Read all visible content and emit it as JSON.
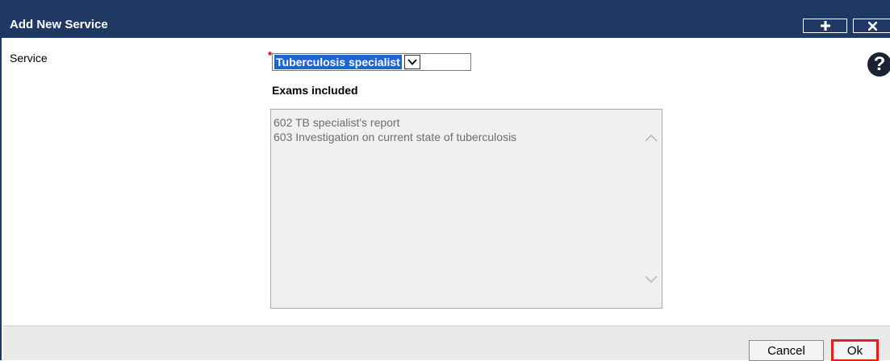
{
  "window": {
    "title": "Add New Service",
    "titlebar_color": "#1f3864",
    "buttons": [
      {
        "name": "maximize",
        "icon": "plus-icon"
      },
      {
        "name": "close",
        "icon": "close-icon"
      }
    ]
  },
  "form": {
    "service_label": "Service",
    "required_marker": "*",
    "service_selected": "Tuberculosis specialist",
    "help_icon": "?",
    "exams_label": "Exams included",
    "exams": [
      "602 TB specialist's report",
      "603 Investigation on current state of tuberculosis"
    ]
  },
  "footer": {
    "cancel_label": "Cancel",
    "ok_label": "Ok",
    "ok_highlight_color": "#e0201c"
  }
}
